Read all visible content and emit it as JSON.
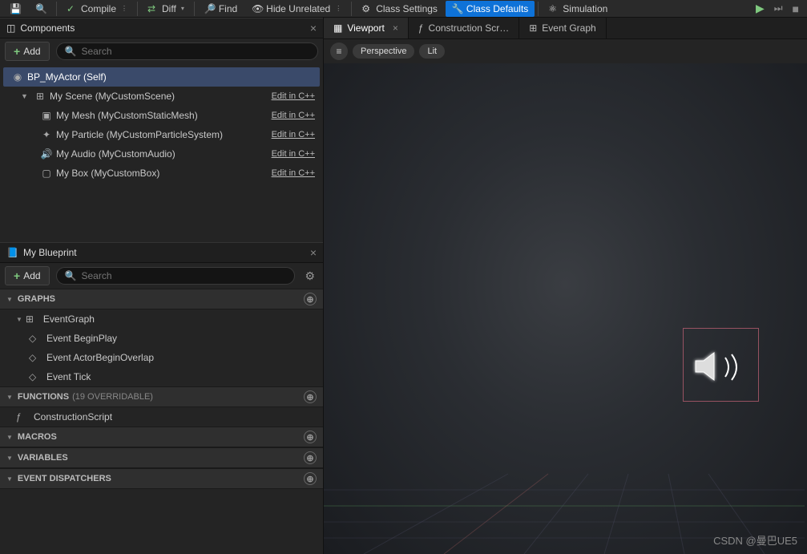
{
  "toolbar": {
    "compile": "Compile",
    "diff": "Diff",
    "find": "Find",
    "hideUnrelated": "Hide Unrelated",
    "classSettings": "Class Settings",
    "classDefaults": "Class Defaults",
    "simulation": "Simulation"
  },
  "panels": {
    "components": {
      "title": "Components",
      "addLabel": "Add",
      "searchPlaceholder": "Search"
    },
    "myBlueprint": {
      "title": "My Blueprint",
      "addLabel": "Add",
      "searchPlaceholder": "Search"
    }
  },
  "componentsTree": {
    "root": "BP_MyActor (Self)",
    "editCpp": "Edit in C++",
    "items": [
      {
        "name": "My Scene (MyCustomScene)"
      },
      {
        "name": "My Mesh (MyCustomStaticMesh)"
      },
      {
        "name": "My Particle (MyCustomParticleSystem)"
      },
      {
        "name": "My Audio (MyCustomAudio)"
      },
      {
        "name": "My Box (MyCustomBox)"
      }
    ]
  },
  "blueprint": {
    "sections": {
      "graphs": "GRAPHS",
      "functions": "FUNCTIONS",
      "functionsCount": "(19 OVERRIDABLE)",
      "macros": "MACROS",
      "variables": "VARIABLES",
      "dispatchers": "EVENT DISPATCHERS"
    },
    "eventGraph": "EventGraph",
    "events": [
      "Event BeginPlay",
      "Event ActorBeginOverlap",
      "Event Tick"
    ],
    "constructionScript": "ConstructionScript"
  },
  "viewport": {
    "tabs": [
      "Viewport",
      "Construction Scr…",
      "Event Graph"
    ],
    "perspective": "Perspective",
    "lit": "Lit"
  },
  "watermark": "CSDN @曼巴UE5"
}
